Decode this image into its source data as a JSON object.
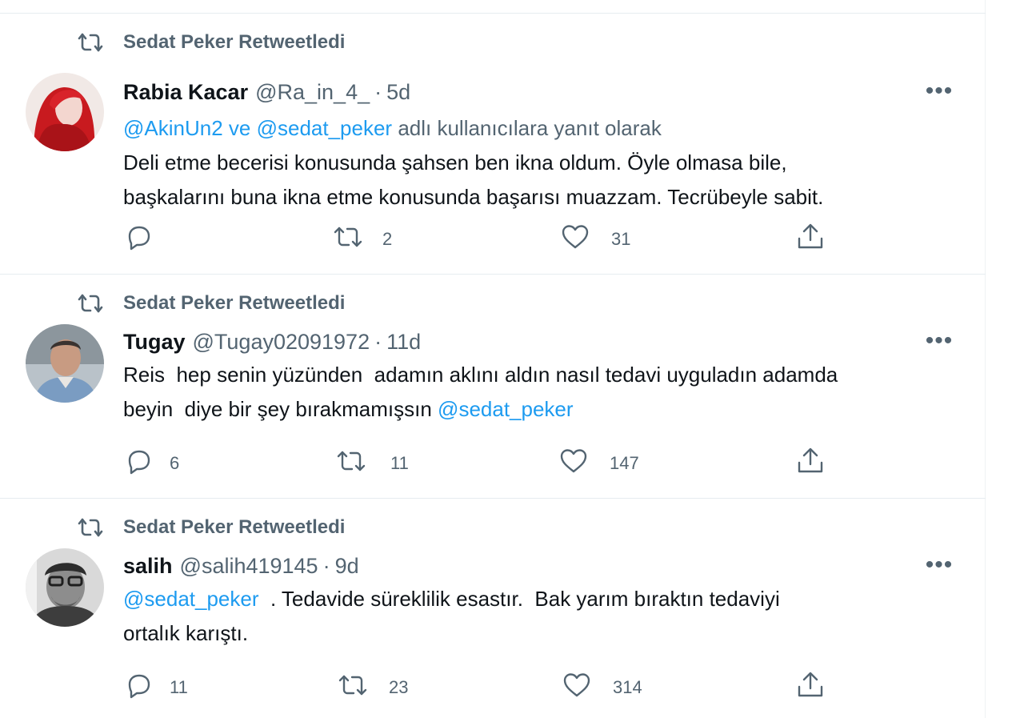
{
  "icons": {
    "retweet": "retweet-icon",
    "reply": "reply-icon",
    "like": "heart-icon",
    "share": "share-icon",
    "more": "more-icon"
  },
  "colors": {
    "link": "#1d9bf0",
    "secondary_text": "#536471",
    "primary_text": "#0f1419",
    "divider": "#e6ecf0"
  },
  "tweets": [
    {
      "retweeted_by": "Sedat Peker Retweetledi",
      "name": "Rabia Kacar",
      "handle": "@Ra_in_4_",
      "dot": "·",
      "time": "5d",
      "more": "•••",
      "reply_to": {
        "mention1": "@AkinUn2",
        "connector": " ve ",
        "mention2": "@sedat_peker",
        "rest": " adlı kullanıcılara yanıt olarak"
      },
      "lines": [
        "Deli etme becerisi konusunda şahsen ben ikna oldum. Öyle olmasa bile,",
        "başkalarını buna ikna etme konusunda başarısı muazzam. Tecrübeyle sabit."
      ],
      "replies": "",
      "retweets": "2",
      "likes": "31"
    },
    {
      "retweeted_by": "Sedat Peker Retweetledi",
      "name": "Tugay",
      "handle": "@Tugay02091972",
      "dot": "·",
      "time": "11d",
      "more": "•••",
      "lines": [
        "Reis  hep senin yüzünden  adamın aklını aldın nasıl tedavi uyguladın adamda"
      ],
      "line2_text": "beyin  diye bir şey bırakmamışsın ",
      "line2_mention": "@sedat_peker",
      "replies": "6",
      "retweets": "11",
      "likes": "147"
    },
    {
      "retweeted_by": "Sedat Peker Retweetledi",
      "name": "salih",
      "handle": "@salih419145",
      "dot": "·",
      "time": "9d",
      "more": "•••",
      "line1_mention": "@sedat_peker",
      "line1_text": "  . Tedavide süreklilik esastır.  Bak yarım bıraktın tedaviyi",
      "lines": [
        "ortalık karıştı."
      ],
      "replies": "11",
      "retweets": "23",
      "likes": "314"
    }
  ]
}
